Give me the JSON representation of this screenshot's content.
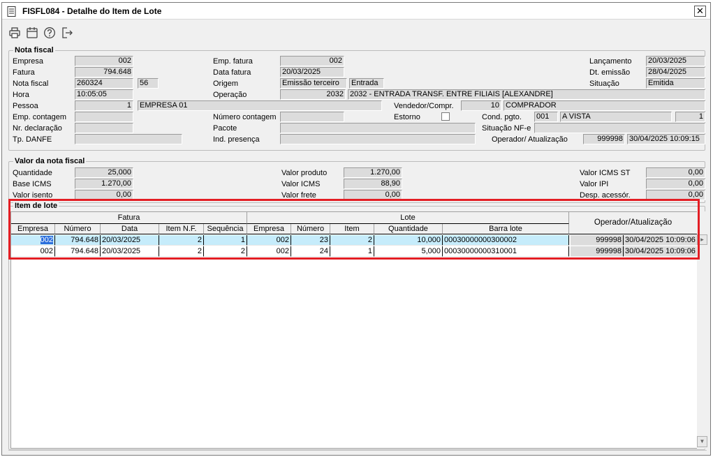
{
  "window": {
    "title": "FISFL084 - Detalhe do Item de Lote",
    "close_glyph": "✕"
  },
  "toolbar": {
    "icons": [
      "printer-icon",
      "calendar-icon",
      "help-icon",
      "exit-icon"
    ]
  },
  "nota_fiscal": {
    "legend": "Nota fiscal",
    "labels": {
      "empresa": "Empresa",
      "fatura": "Fatura",
      "nota_fiscal": "Nota fiscal",
      "hora": "Hora",
      "pessoa": "Pessoa",
      "emp_contagem": "Emp. contagem",
      "nr_declaracao": "Nr. declaração",
      "tp_danfe": "Tp. DANFE",
      "emp_fatura": "Emp. fatura",
      "data_fatura": "Data fatura",
      "origem": "Origem",
      "operacao": "Operação",
      "numero_contagem": "Número contagem",
      "pacote": "Pacote",
      "ind_presenca": "Ind. presença",
      "vendedor": "Vendedor/Compr.",
      "estorno": "Estorno",
      "cond_pgto": "Cond. pgto.",
      "situacao_nfe": "Situação NF-e",
      "operador": "Operador/ Atualização",
      "lancamento": "Lançamento",
      "dt_emissao": "Dt. emissão",
      "situacao": "Situação"
    },
    "values": {
      "empresa": "002",
      "fatura": "794.648",
      "nota_fiscal": "260324",
      "serie": "56",
      "hora": "10:05:05",
      "pessoa_codigo": "1",
      "pessoa_nome": "EMPRESA 01",
      "emp_fatura": "002",
      "data_fatura": "20/03/2025",
      "origem": "Emissão terceiro",
      "origem_tipo": "Entrada",
      "operacao_codigo": "2032",
      "operacao_descricao": "2032 - ENTRADA TRANSF. ENTRE FILIAIS [ALEXANDRE]",
      "vendedor_codigo": "10",
      "vendedor_nome": "COMPRADOR",
      "cond_pgto_codigo": "001",
      "cond_pgto_nome": "A VISTA",
      "cond_pgto_parcelas": "1",
      "operador_codigo": "999998",
      "operador_data": "30/04/2025 10:09:15",
      "lancamento": "20/03/2025",
      "dt_emissao": "28/04/2025",
      "situacao": "Emitida"
    }
  },
  "valor_nota": {
    "legend": "Valor da nota fiscal",
    "labels": {
      "quantidade": "Quantidade",
      "base_icms": "Base ICMS",
      "valor_isento": "Valor isento",
      "valor_produto": "Valor produto",
      "valor_icms": "Valor ICMS",
      "valor_frete": "Valor frete",
      "valor_icms_st": "Valor ICMS ST",
      "valor_ipi": "Valor IPI",
      "desp_acessor": "Desp. acessór."
    },
    "values": {
      "quantidade": "25,000",
      "base_icms": "1.270,00",
      "valor_isento": "0,00",
      "valor_produto": "1.270,00",
      "valor_icms": "88,90",
      "valor_frete": "0,00",
      "valor_icms_st": "0,00",
      "valor_ipi": "0,00",
      "desp_acessor": "0,00"
    }
  },
  "item_lote": {
    "legend": "Item de lote",
    "group_headers": {
      "fatura": "Fatura",
      "lote": "Lote",
      "operador": "Operador/Atualização"
    },
    "columns": [
      "Empresa",
      "Número",
      "Data",
      "Item N.F.",
      "Sequência",
      "Empresa",
      "Número",
      "Item",
      "Quantidade",
      "Barra lote"
    ],
    "rows": [
      [
        "002",
        "794.648",
        "20/03/2025",
        "2",
        "1",
        "002",
        "23",
        "2",
        "10,000",
        "00030000000300002",
        "999998",
        "30/04/2025 10:09:06"
      ],
      [
        "002",
        "794.648",
        "20/03/2025",
        "2",
        "2",
        "002",
        "24",
        "1",
        "5,000",
        "00030000000310001",
        "999998",
        "30/04/2025 10:09:06"
      ]
    ]
  },
  "colors": {
    "highlight": "#e31e24",
    "selected_row": "#c6ecfb",
    "field_bg": "#dcdcdc"
  }
}
